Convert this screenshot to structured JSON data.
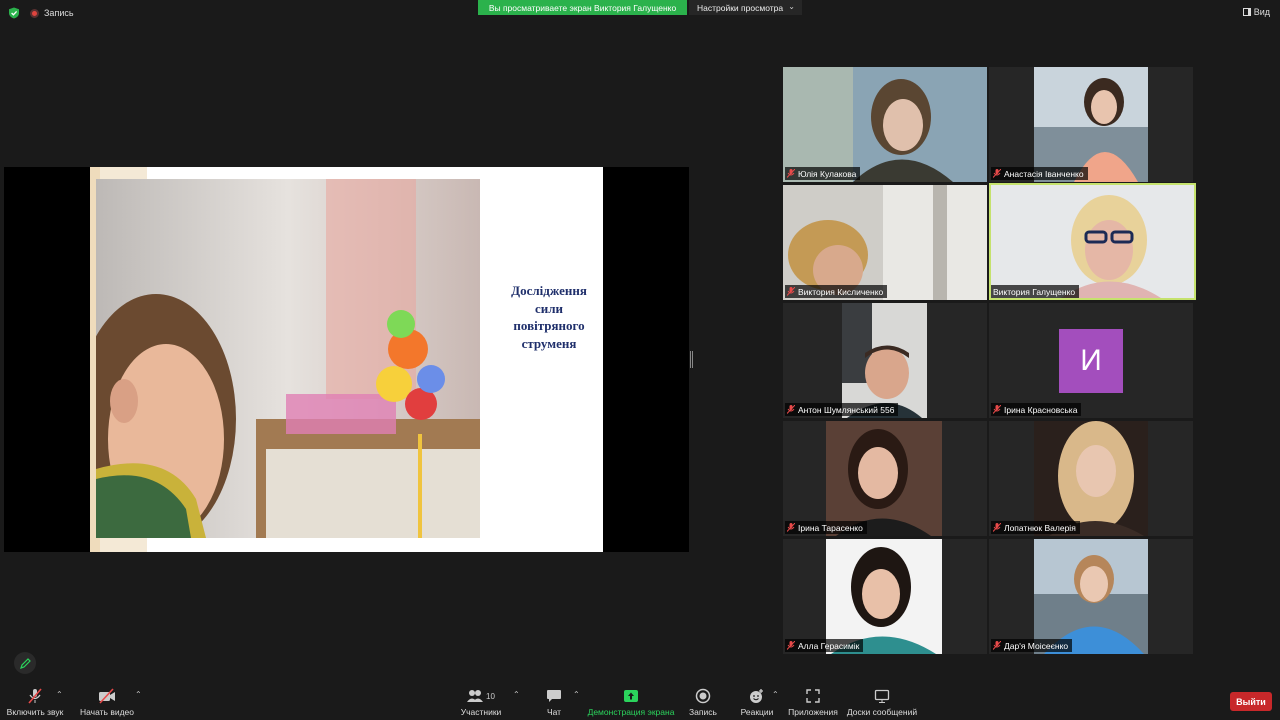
{
  "topbar": {
    "recording_label": "Запись",
    "share_banner": "Вы просматриваете экран Виктория Галущенко",
    "view_settings": "Настройки просмотра",
    "view_button": "Вид"
  },
  "slide": {
    "title_lines": [
      "Дослідження",
      "сили",
      "повітряного",
      "струменя"
    ]
  },
  "participants": [
    {
      "name": "Юлія Кулакова"
    },
    {
      "name": "Анастасія Іванченко"
    },
    {
      "name": "Виктория Кисличенко"
    },
    {
      "name": "Виктория Галущенко"
    },
    {
      "name": "Антон Шумлянський 556"
    },
    {
      "name": "Ірина Красновська",
      "initial": "И"
    },
    {
      "name": "Ірина Тарасенко"
    },
    {
      "name": "Лопатнюк Валерія"
    },
    {
      "name": "Алла Герасимік"
    },
    {
      "name": "Дар'я Моісеєнко"
    }
  ],
  "toolbar": {
    "unmute": "Включить звук",
    "start_video": "Начать видео",
    "participants": "Участники",
    "participants_count": "10",
    "chat": "Чат",
    "share_screen": "Демонстрация экрана",
    "record": "Запись",
    "reactions": "Реакции",
    "apps": "Приложения",
    "whiteboards": "Доски сообщений",
    "leave": "Выйти"
  },
  "colors": {
    "accent_green": "#2bb24c",
    "active_speaker": "#c5e26d",
    "leave_red": "#c8282a",
    "avatar_purple": "#a34ebd",
    "slide_title": "#1f2f6b"
  }
}
